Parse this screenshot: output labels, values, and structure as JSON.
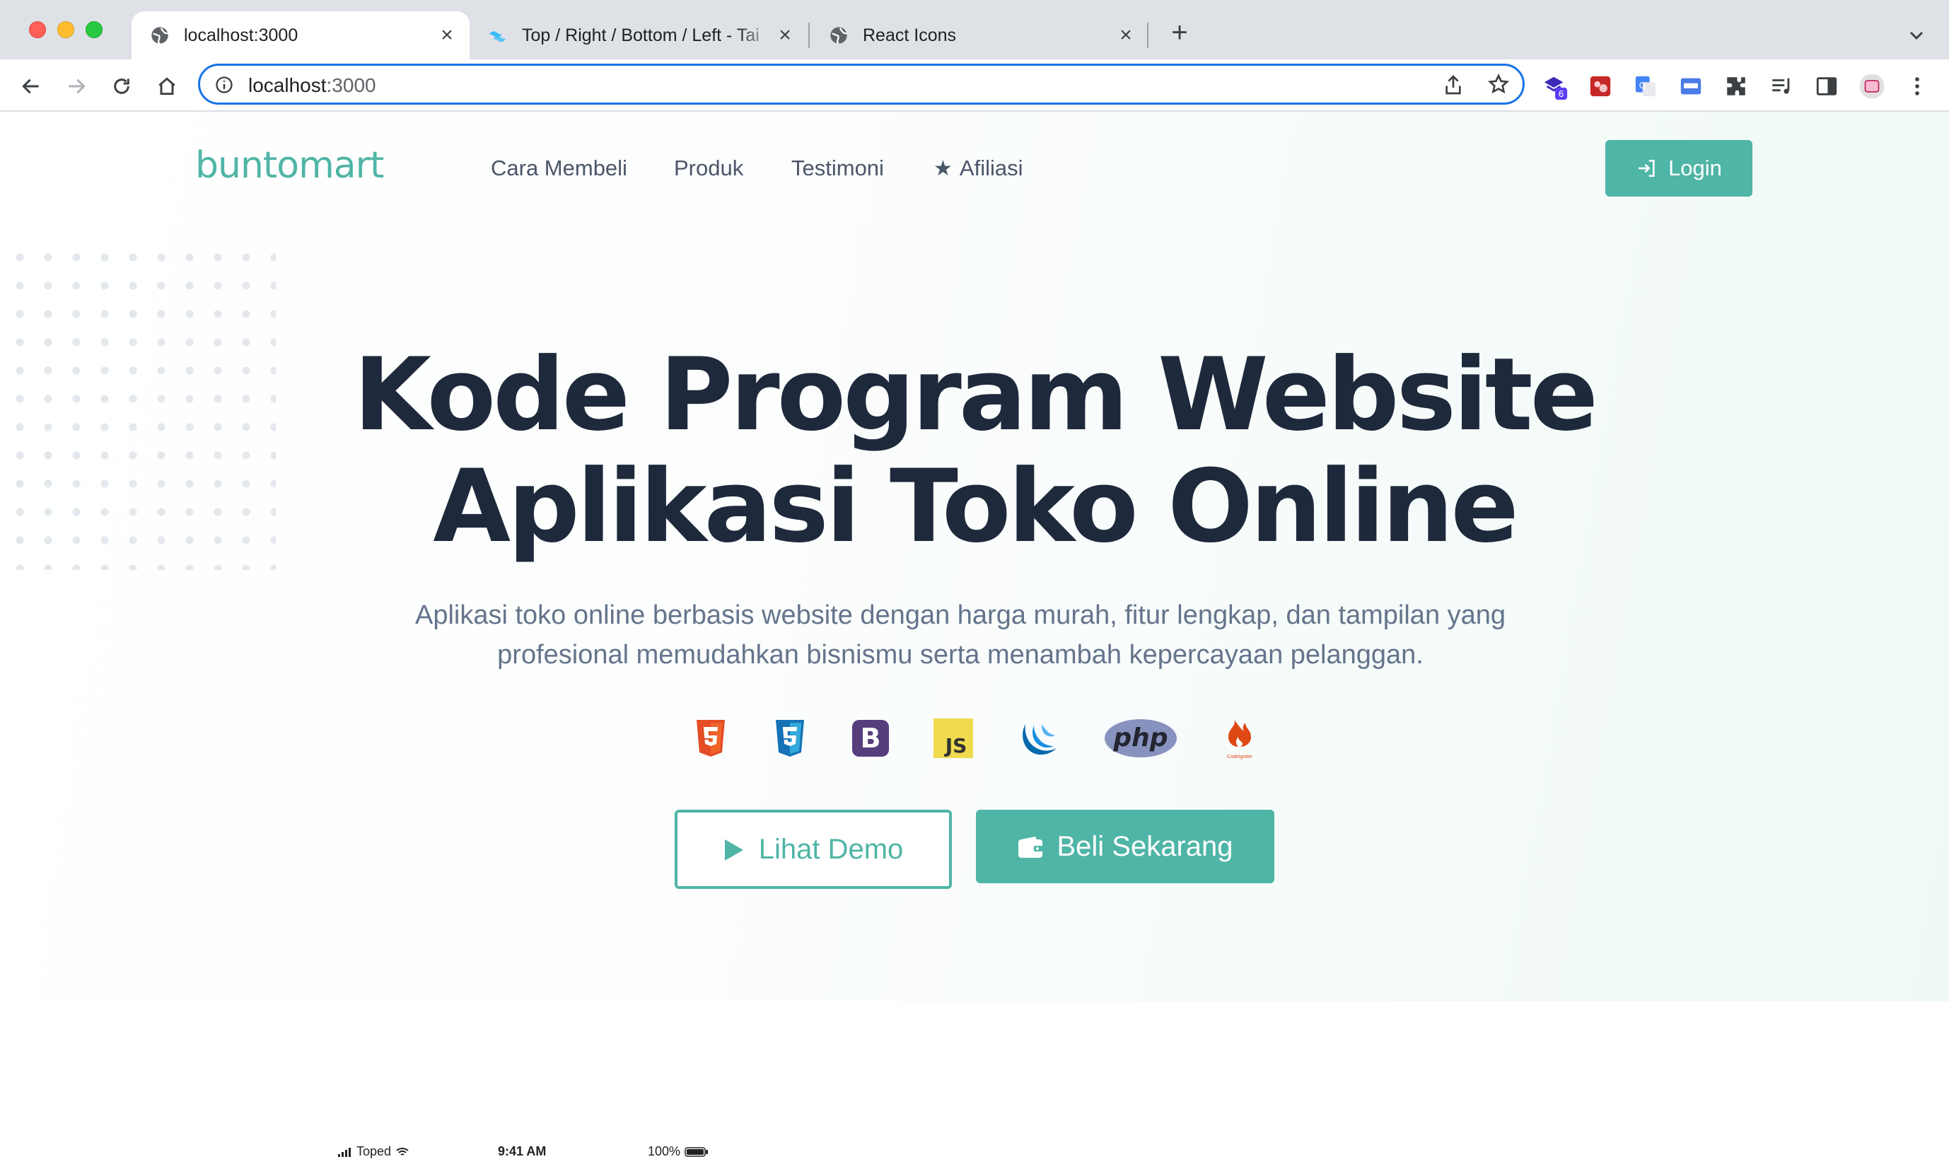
{
  "browser": {
    "tabs": [
      {
        "title": "localhost:3000",
        "active": true
      },
      {
        "title": "Top / Right / Bottom / Left - Tai",
        "active": false
      },
      {
        "title": "React Icons",
        "active": false
      }
    ],
    "address": {
      "host": "localhost",
      "port": ":3000"
    },
    "extension_badge": "6"
  },
  "nav": {
    "logo": "buntomart",
    "items": [
      "Cara Membeli",
      "Produk",
      "Testimoni",
      "Afiliasi"
    ],
    "login_label": "Login"
  },
  "hero": {
    "title_line1": "Kode Program Website",
    "title_line2": "Aplikasi Toko Online",
    "subtitle_line1": "Aplikasi toko online berbasis website dengan harga murah, fitur lengkap, dan tampilan yang",
    "subtitle_line2": "profesional memudahkan bisnismu serta menambah kepercayaan pelanggan.",
    "tech_icons": [
      "html5-icon",
      "css3-icon",
      "bootstrap-icon",
      "javascript-icon",
      "jquery-icon",
      "php-icon",
      "codeigniter-icon"
    ],
    "tech_labels": {
      "bootstrap": "B",
      "javascript": "JS",
      "php": "php",
      "codeigniter": "CodeIgniter"
    },
    "demo_label": "Lihat Demo",
    "buy_label": "Beli Sekarang"
  },
  "phone_mockup": {
    "carrier": "Toped",
    "time": "9:41 AM",
    "battery": "100%"
  },
  "colors": {
    "accent": "#4fb5a6",
    "heading": "#1e293b",
    "body_text": "#64748b",
    "omnibox_focus": "#1a73e8"
  }
}
